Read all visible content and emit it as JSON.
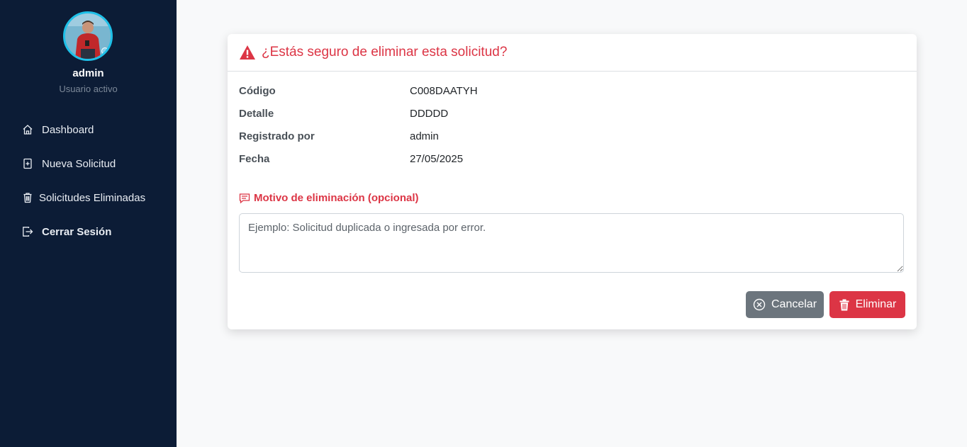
{
  "sidebar": {
    "user": {
      "name": "admin",
      "status": "Usuario activo"
    },
    "items": [
      {
        "label": "Dashboard",
        "icon": "home-icon"
      },
      {
        "label": "Nueva Solicitud",
        "icon": "file-plus-icon"
      },
      {
        "label": "Solicitudes Eliminadas",
        "icon": "trash-icon"
      },
      {
        "label": "Cerrar Sesión",
        "icon": "logout-icon"
      }
    ]
  },
  "modal": {
    "title": "¿Estás seguro de eliminar esta solicitud?",
    "fields": [
      {
        "label": "Código",
        "value": "C008DAATYH"
      },
      {
        "label": "Detalle",
        "value": "DDDDD"
      },
      {
        "label": "Registrado por",
        "value": "admin"
      },
      {
        "label": "Fecha",
        "value": "27/05/2025"
      }
    ],
    "reason_label": "Motivo de eliminación (opcional)",
    "reason_placeholder": "Ejemplo: Solicitud duplicada o ingresada por error.",
    "cancel_label": "Cancelar",
    "delete_label": "Eliminar"
  },
  "colors": {
    "sidebar_bg": "#0c1c36",
    "danger": "#dc3545",
    "secondary": "#6c757d",
    "avatar_ring": "#1ec0e8"
  }
}
